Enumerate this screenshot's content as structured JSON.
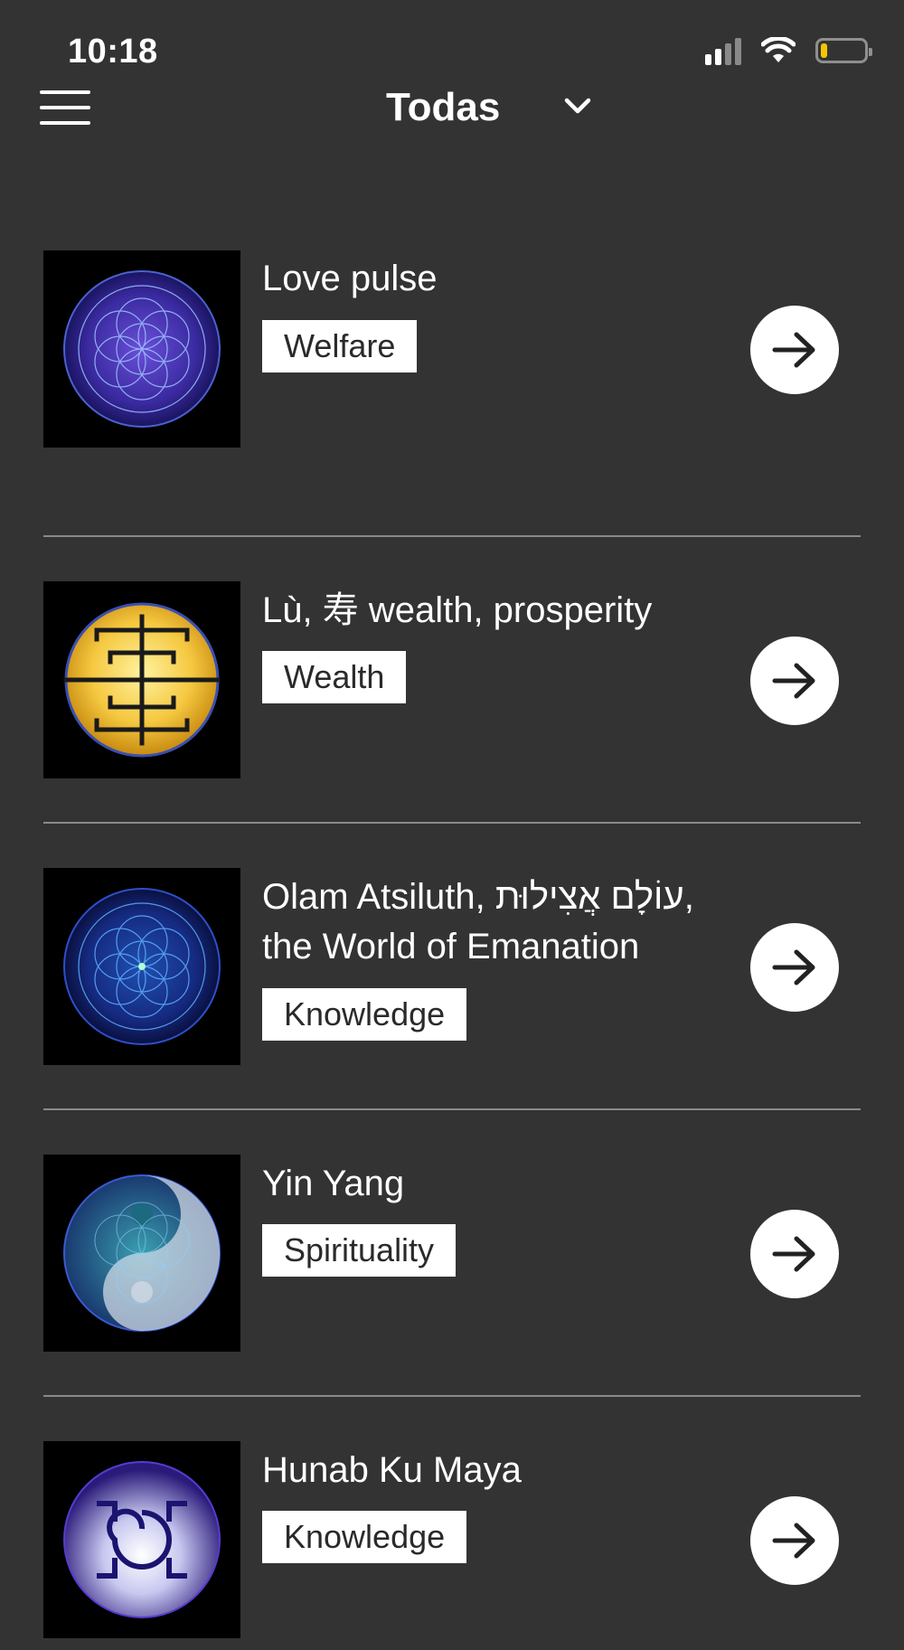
{
  "status_bar": {
    "time": "10:18",
    "battery_level": 0.15,
    "battery_color": "#f5c400"
  },
  "header": {
    "title": "Todas",
    "menu_icon": "hamburger-menu-icon",
    "dropdown_icon": "chevron-down-icon"
  },
  "items": [
    {
      "title": "Love pulse",
      "tag": "Welfare",
      "image": "flower-of-life-purple"
    },
    {
      "title": " Lù, 寿 wealth, prosperity",
      "tag": "Wealth",
      "image": "golden-shou-symbol"
    },
    {
      "title": "Olam Atsiluth, עוֹלָם אֲצִילוּת, the World of Emanation",
      "tag": "Knowledge",
      "image": "flower-of-life-blue"
    },
    {
      "title": "Yin Yang",
      "tag": "Spirituality",
      "image": "yin-yang-flower-of-life"
    },
    {
      "title": "Hunab Ku Maya",
      "tag": "Knowledge",
      "image": "hunab-ku-symbol"
    }
  ],
  "colors": {
    "background": "#333333",
    "divider": "#8a8a8a",
    "tag_background": "#ffffff",
    "button_background": "#ffffff"
  }
}
